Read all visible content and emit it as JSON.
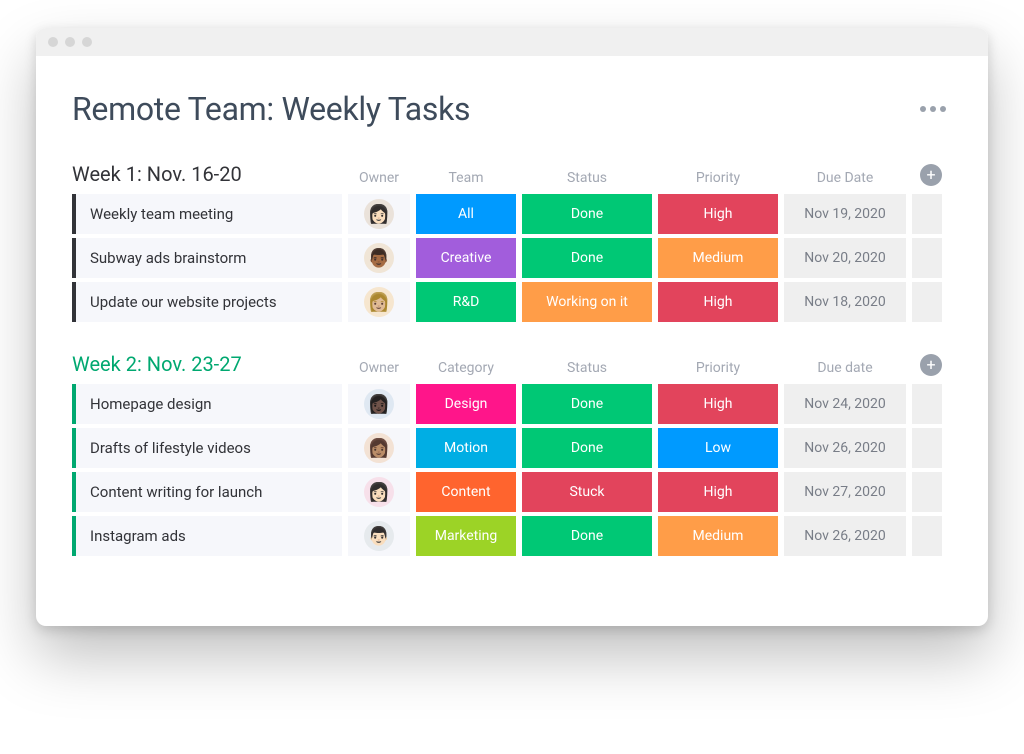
{
  "title": "Remote Team: Weekly Tasks",
  "colors": {
    "blue": "#009aff",
    "green": "#00c875",
    "red": "#e2445c",
    "purple": "#a25ddc",
    "orange": "#ff9d48",
    "magenta": "#ff158a",
    "deeporange": "#ff642e",
    "lime": "#9cd326",
    "cyan": "#00aee4",
    "pale": "#efefef"
  },
  "groups": [
    {
      "title": "Week 1: Nov. 16-20",
      "accent": false,
      "headers": {
        "owner": "Owner",
        "team": "Team",
        "status": "Status",
        "priority": "Priority",
        "due": "Due Date"
      },
      "rows": [
        {
          "task": "Weekly team meeting",
          "ownerAvatar": "👩🏻",
          "ownerBg": "#eae2da",
          "team": {
            "label": "All",
            "color": "blue"
          },
          "status": {
            "label": "Done",
            "color": "green"
          },
          "priority": {
            "label": "High",
            "color": "red"
          },
          "due": "Nov 19, 2020"
        },
        {
          "task": "Subway ads brainstorm",
          "ownerAvatar": "👨🏾",
          "ownerBg": "#f0e5d6",
          "team": {
            "label": "Creative",
            "color": "purple"
          },
          "status": {
            "label": "Done",
            "color": "green"
          },
          "priority": {
            "label": "Medium",
            "color": "orange"
          },
          "due": "Nov 20, 2020"
        },
        {
          "task": "Update our website projects",
          "ownerAvatar": "👩🏼",
          "ownerBg": "#f6e6cf",
          "team": {
            "label": "R&D",
            "color": "green"
          },
          "status": {
            "label": "Working on it",
            "color": "orange"
          },
          "priority": {
            "label": "High",
            "color": "red"
          },
          "due": "Nov 18, 2020"
        }
      ]
    },
    {
      "title": "Week 2: Nov. 23-27",
      "accent": true,
      "headers": {
        "owner": "Owner",
        "team": "Category",
        "status": "Status",
        "priority": "Priority",
        "due": "Due date"
      },
      "rows": [
        {
          "task": "Homepage design",
          "ownerAvatar": "👩🏿",
          "ownerBg": "#dfe8f2",
          "team": {
            "label": "Design",
            "color": "magenta"
          },
          "status": {
            "label": "Done",
            "color": "green"
          },
          "priority": {
            "label": "High",
            "color": "red"
          },
          "due": "Nov 24, 2020"
        },
        {
          "task": "Drafts of lifestyle videos",
          "ownerAvatar": "👩🏽",
          "ownerBg": "#f3e2d4",
          "team": {
            "label": "Motion",
            "color": "cyan"
          },
          "status": {
            "label": "Done",
            "color": "green"
          },
          "priority": {
            "label": "Low",
            "color": "blue"
          },
          "due": "Nov 26, 2020"
        },
        {
          "task": "Content writing for launch",
          "ownerAvatar": "👩🏻",
          "ownerBg": "#f7e0ea",
          "team": {
            "label": "Content",
            "color": "deeporange"
          },
          "status": {
            "label": "Stuck",
            "color": "red"
          },
          "priority": {
            "label": "High",
            "color": "red"
          },
          "due": "Nov 27, 2020"
        },
        {
          "task": "Instagram ads",
          "ownerAvatar": "👨🏻",
          "ownerBg": "#e6eaed",
          "team": {
            "label": "Marketing",
            "color": "lime"
          },
          "status": {
            "label": "Done",
            "color": "green"
          },
          "priority": {
            "label": "Medium",
            "color": "orange"
          },
          "due": "Nov 26, 2020"
        }
      ]
    }
  ]
}
